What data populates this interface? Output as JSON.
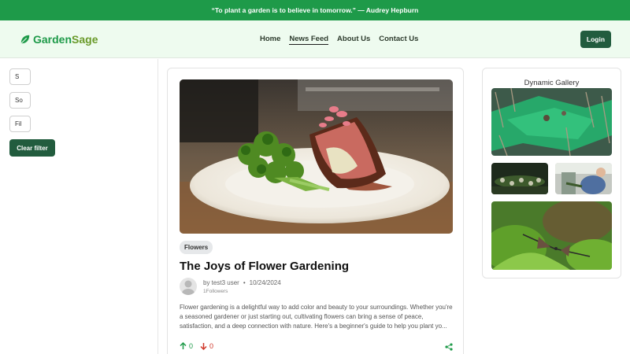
{
  "quote": "“To plant a garden is to believe in tomorrow.” — Audrey Hepburn",
  "brand": {
    "part1": "Garden",
    "part2": "Sage"
  },
  "nav": {
    "items": [
      "Home",
      "News Feed",
      "About Us",
      "Contact Us"
    ],
    "active": "News Feed",
    "login_label": "Login"
  },
  "sidebar": {
    "search_value": "S",
    "sort_value": "So",
    "filter_value": "Fil",
    "clear_label": "Clear filter"
  },
  "post": {
    "tag": "Flowers",
    "title": "The Joys of Flower Gardening",
    "author": "by test3 user",
    "date": "10/24/2024",
    "followers": "1Followers",
    "excerpt": "Flower gardening is a delightful way to add color and beauty to your surroundings. Whether you're a seasoned gardener or just starting out, cultivating flowers can bring a sense of peace, satisfaction, and a deep connection with nature. Here's a beginner's guide to help you plant yo...",
    "upvotes": "0",
    "downvotes": "0"
  },
  "gallery": {
    "title": "Dynamic Gallery"
  },
  "colors": {
    "primary_green": "#1e9a49",
    "dark_green": "#225c3e",
    "nav_bg": "#eefbef",
    "downvote_red": "#d0392b"
  },
  "icons": [
    "leaf-icon",
    "arrow-up-icon",
    "arrow-down-icon",
    "share-icon",
    "user-avatar-icon"
  ]
}
